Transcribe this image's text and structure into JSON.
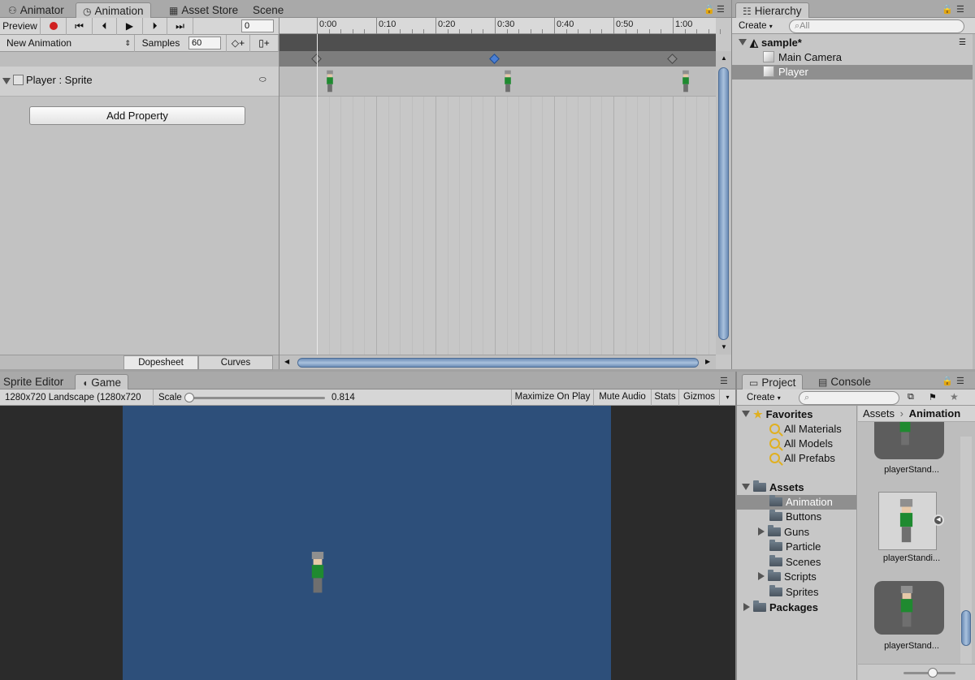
{
  "top_tabs": {
    "animator": "Animator",
    "animation": "Animation",
    "asset_store": "Asset Store",
    "scene": "Scene"
  },
  "animation": {
    "preview_label": "Preview",
    "frame_value": "0",
    "clip_name": "New Animation",
    "samples_label": "Samples",
    "samples_value": "60",
    "property_label": "Player : Sprite",
    "add_property_label": "Add Property",
    "dopesheet_label": "Dopesheet",
    "curves_label": "Curves",
    "ruler_ticks": [
      "0:00",
      "0:10",
      "0:20",
      "0:30",
      "0:40",
      "0:50",
      "1:00"
    ],
    "keyframes": [
      0,
      30,
      60
    ]
  },
  "hierarchy": {
    "tab_label": "Hierarchy",
    "create_label": "Create",
    "search_placeholder": "All",
    "scene_name": "sample*",
    "items": [
      "Main Camera",
      "Player"
    ]
  },
  "game_tabs": {
    "sprite_editor": "Sprite Editor",
    "game": "Game"
  },
  "game": {
    "resolution": "1280x720 Landscape (1280x720",
    "scale_label": "Scale",
    "scale_value": "0.814",
    "maximize_label": "Maximize On Play",
    "mute_label": "Mute Audio",
    "stats_label": "Stats",
    "gizmos_label": "Gizmos",
    "background_color": "#2d4f7a"
  },
  "project": {
    "project_tab": "Project",
    "console_tab": "Console",
    "create_label": "Create",
    "favorites_label": "Favorites",
    "favorites": [
      "All Materials",
      "All Models",
      "All Prefabs"
    ],
    "assets_label": "Assets",
    "asset_folders": [
      "Animation",
      "Buttons",
      "Guns",
      "Particle",
      "Scenes",
      "Scripts",
      "Sprites"
    ],
    "packages_label": "Packages",
    "breadcrumb_root": "Assets",
    "breadcrumb_current": "Animation",
    "thumbnails": [
      "playerStand...",
      "playerStandi...",
      "playerStand..."
    ]
  }
}
